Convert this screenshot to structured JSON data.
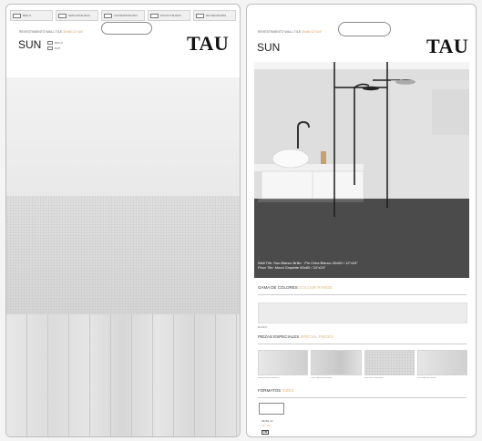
{
  "left": {
    "chips": [
      "BRILLO",
      "MATE SUN BLANCO",
      "SUN DECOR BLANCO",
      "SUN PLOT BLANCO",
      "SUN DECOR MATE"
    ],
    "series_dark": "REVESTIMIENTO WALL TILE ",
    "series_accent": "30x60 12\"x24\"",
    "collection": "SUN",
    "finish_1": "BRILLO",
    "finish_2": "MATT",
    "brand": "TAU"
  },
  "right": {
    "series_dark": "REVESTIMIENTO WALL TILE ",
    "series_accent": "30x60 12\"x24\"",
    "collection": "SUN",
    "brand": "TAU",
    "caption_1": "Wall Tile: Sun Blanco Brillo · Plo Cima Blanco 30x60 / 12\"x24\"",
    "caption_2": "Floor Tile: Mood Graphite 60x60 / 24\"x24\"",
    "colour_range_dark": "GAMA DE COLORES ",
    "colour_range_accent": "COLOUR RANGE",
    "swatch_label": "BLANCO",
    "special_pieces_dark": "PIEZAS ESPECIALES ",
    "special_pieces_accent": "SPECIAL PIECES",
    "pieces": [
      "SUN BLANCO BRILLO",
      "SUN DECOR BLANCO",
      "SUN PLOT BLANCO",
      "SUN DECOR MATE"
    ],
    "formats_dark": "FORMATOS ",
    "formats_accent": "SIZES",
    "format_size": "30x60 cm",
    "format_inches": "12\"x24\"",
    "cm_badge": "CM"
  },
  "colors": {
    "accent": "#e0b57f",
    "brand": "#111111"
  }
}
